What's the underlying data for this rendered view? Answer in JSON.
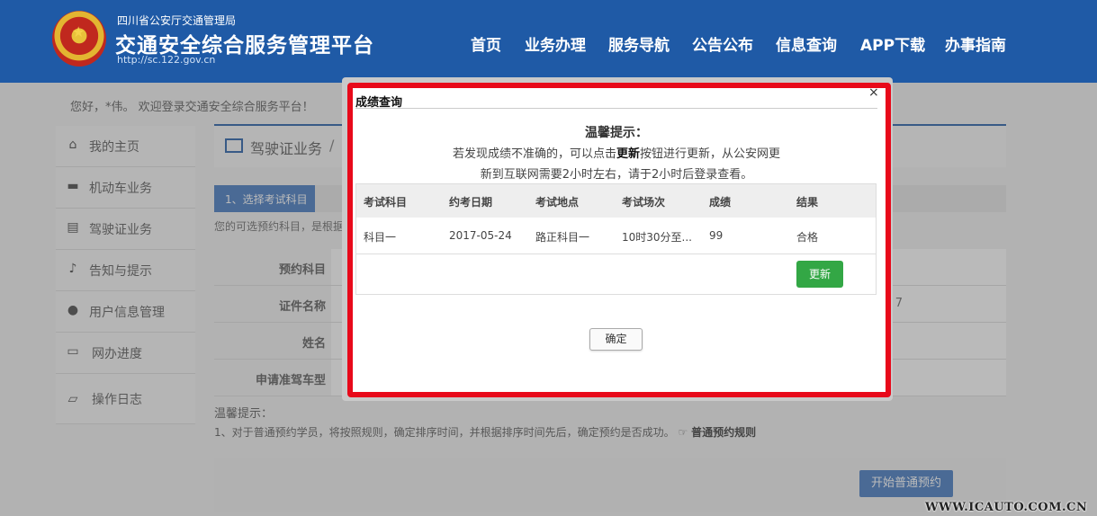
{
  "header": {
    "org": "四川省公安厅交通管理局",
    "title": "交通安全综合服务管理平台",
    "url": "http://sc.122.gov.cn",
    "nav": [
      "首页",
      "业务办理",
      "服务导航",
      "公告公布",
      "信息查询",
      "APP下载",
      "办事指南"
    ]
  },
  "welcome": "您好，*伟。 欢迎登录交通安全综合服务平台！",
  "sidebar": {
    "items": [
      {
        "label": "我的主页",
        "icon": "home-icon"
      },
      {
        "label": "机动车业务",
        "icon": "truck-icon"
      },
      {
        "label": "驾驶证业务",
        "icon": "card-icon"
      },
      {
        "label": "告知与提示",
        "icon": "bell-icon"
      },
      {
        "label": "用户信息管理",
        "icon": "user-icon"
      },
      {
        "label": "网办进度",
        "icon": "progress-icon"
      },
      {
        "label": "操作日志",
        "icon": "log-icon"
      }
    ]
  },
  "main": {
    "section": "驾驶证业务",
    "separator": "/",
    "step": "1、选择考试科目",
    "hint": "您的可选预约科目，是根据",
    "form": [
      {
        "label": "预约科目",
        "value": ""
      },
      {
        "label": "证件名称",
        "value": "7"
      },
      {
        "label": "姓名",
        "value": ""
      },
      {
        "label": "申请准驾车型",
        "value": ""
      }
    ],
    "tips_title": "温馨提示：",
    "tips_line": "1、对于普通预约学员，将按照规则，确定排序时间，并根据排序时间先后，确定预约是否成功。",
    "tips_link": "普通预约规则",
    "start_button": "开始普通预约"
  },
  "modal": {
    "title": "成绩查询",
    "close": "×",
    "tip_head": "温馨提示：",
    "tip_line1_pre": "若发现成绩不准确的，可以点击",
    "tip_line1_bold": "更新",
    "tip_line1_post": "按钮进行更新，从公安网更",
    "tip_line2": "新到互联网需要2小时左右，请于2小时后登录查看。",
    "table": {
      "headers": [
        "考试科目",
        "约考日期",
        "考试地点",
        "考试场次",
        "成绩",
        "结果"
      ],
      "rows": [
        [
          "科目一",
          "2017-05-24",
          "路正科目一",
          "10时30分至...",
          "99",
          "合格"
        ]
      ]
    },
    "update_button": "更新",
    "ok_button": "确定"
  },
  "watermark": "WWW.ICAUTO.COM.CN",
  "colors": {
    "header_bg": "#1f5aa6",
    "highlight_border": "#e8091a",
    "update_green": "#33a745"
  }
}
